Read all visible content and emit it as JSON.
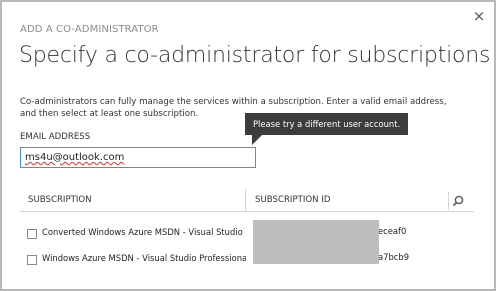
{
  "dialog": {
    "header": "ADD A CO-ADMINISTRATOR",
    "title": "Specify a co-administrator for subscriptions",
    "description": "Co-administrators can fully manage the services within a subscription. Enter a valid email address, and then select at least one subscription.",
    "close_label": "×"
  },
  "email": {
    "label": "EMAIL ADDRESS",
    "value": "ms4u@outlook.com",
    "tooltip": "Please try a different user account."
  },
  "table": {
    "columns": [
      "SUBSCRIPTION",
      "SUBSCRIPTION ID"
    ],
    "search_icon": "search-icon",
    "rows": [
      {
        "name": "Converted Windows Azure MSDN - Visual Studio Premium",
        "id": "eceaf0"
      },
      {
        "name": "Windows Azure MSDN - Visual Studio Professional",
        "id": "a7bcb9"
      }
    ]
  }
}
